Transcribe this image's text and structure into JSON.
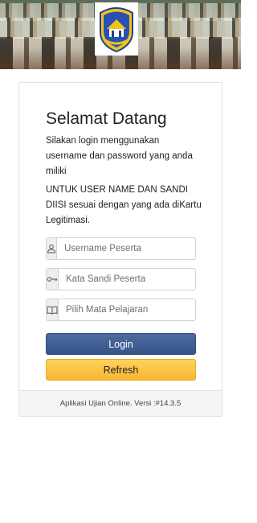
{
  "banner": {
    "logo_alt": "school-logo"
  },
  "welcome": {
    "title": "Selamat Datang",
    "description": "Silakan login menggunakan username dan password yang anda miliki",
    "notice": "UNTUK USER NAME DAN SANDI DIISI sesuai dengan yang ada diKartu Legitimasi."
  },
  "form": {
    "username": {
      "placeholder": "Username Peserta",
      "value": "",
      "icon": "user-icon"
    },
    "password": {
      "placeholder": "Kata Sandi Peserta",
      "value": "",
      "icon": "key-icon"
    },
    "subject": {
      "placeholder": "Pilih Mata Pelajaran",
      "value": "",
      "icon": "book-icon"
    }
  },
  "buttons": {
    "login_label": "Login",
    "refresh_label": "Refresh"
  },
  "footer": {
    "text": "Aplikasi Ujian Online. Versi :#14.3.5"
  },
  "colors": {
    "login_button": "#34558a",
    "refresh_button": "#f7b731",
    "logo_blue": "#1f3f9a",
    "logo_yellow": "#f2c314"
  }
}
